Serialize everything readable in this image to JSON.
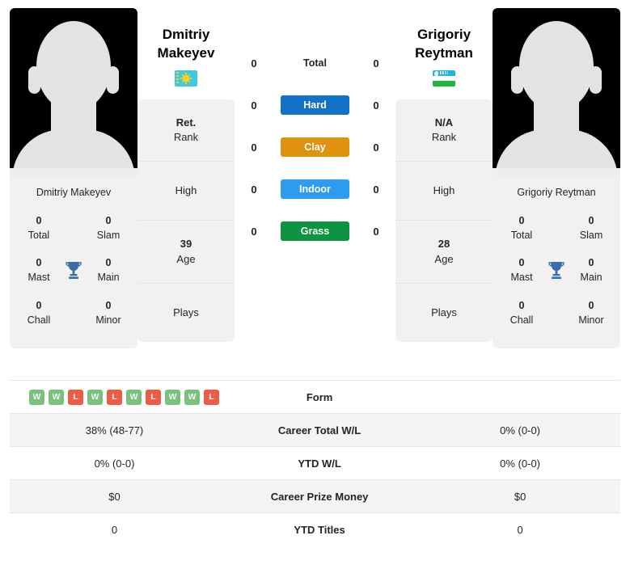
{
  "players": {
    "left": {
      "first_name": "Dmitriy",
      "last_name": "Makeyev",
      "full_name": "Dmitriy Makeyev",
      "country_flag": "kazakhstan-flag",
      "titles": {
        "total_value": "0",
        "total_label": "Total",
        "slam_value": "0",
        "slam_label": "Slam",
        "mast_value": "0",
        "mast_label": "Mast",
        "main_value": "0",
        "main_label": "Main",
        "chall_value": "0",
        "chall_label": "Chall",
        "minor_value": "0",
        "minor_label": "Minor"
      },
      "info": {
        "rank_value": "Ret.",
        "rank_label": "Rank",
        "high_value": "",
        "high_label": "High",
        "age_value": "39",
        "age_label": "Age",
        "plays_value": "",
        "plays_label": "Plays"
      },
      "surface_wins": {
        "total": "0",
        "hard": "0",
        "clay": "0",
        "indoor": "0",
        "grass": "0"
      }
    },
    "right": {
      "first_name": "Grigoriy",
      "last_name": "Reytman",
      "full_name": "Grigoriy Reytman",
      "country_flag": "uzbekistan-flag",
      "titles": {
        "total_value": "0",
        "total_label": "Total",
        "slam_value": "0",
        "slam_label": "Slam",
        "mast_value": "0",
        "mast_label": "Mast",
        "main_value": "0",
        "main_label": "Main",
        "chall_value": "0",
        "chall_label": "Chall",
        "minor_value": "0",
        "minor_label": "Minor"
      },
      "info": {
        "rank_value": "N/A",
        "rank_label": "Rank",
        "high_value": "",
        "high_label": "High",
        "age_value": "28",
        "age_label": "Age",
        "plays_value": "",
        "plays_label": "Plays"
      },
      "surface_wins": {
        "total": "0",
        "hard": "0",
        "clay": "0",
        "indoor": "0",
        "grass": "0"
      }
    }
  },
  "surfaces": [
    {
      "key": "total",
      "label": "Total",
      "color": "transparent",
      "text_color": "#212529"
    },
    {
      "key": "hard",
      "label": "Hard",
      "color": "#1273c6",
      "text_color": "#ffffff"
    },
    {
      "key": "clay",
      "label": "Clay",
      "color": "#de9210",
      "text_color": "#ffffff"
    },
    {
      "key": "indoor",
      "label": "Indoor",
      "color": "#2d9cf0",
      "text_color": "#ffffff"
    },
    {
      "key": "grass",
      "label": "Grass",
      "color": "#0e9340",
      "text_color": "#ffffff"
    }
  ],
  "form": {
    "label": "Form",
    "left_results": [
      "W",
      "W",
      "L",
      "W",
      "L",
      "W",
      "L",
      "W",
      "W",
      "L"
    ],
    "right_results": [],
    "win_color": "#7ac17e",
    "loss_color": "#eb5c46"
  },
  "stats_rows": [
    {
      "label": "Career Total W/L",
      "left": "38% (48-77)",
      "right": "0% (0-0)"
    },
    {
      "label": "YTD W/L",
      "left": "0% (0-0)",
      "right": "0% (0-0)"
    },
    {
      "label": "Career Prize Money",
      "left": "$0",
      "right": "$0"
    },
    {
      "label": "YTD Titles",
      "left": "0",
      "right": "0"
    }
  ],
  "icons": {
    "trophy": "trophy-icon"
  }
}
